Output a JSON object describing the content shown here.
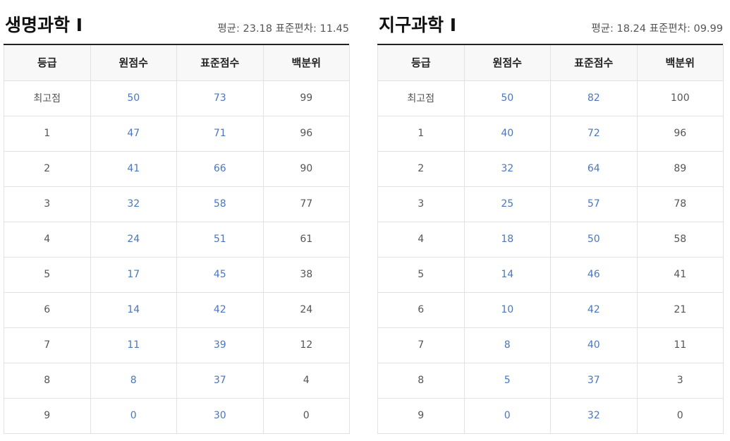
{
  "tables": [
    {
      "title": "생명과학 Ⅰ",
      "mean_label": "평균:",
      "mean_value": "23.18",
      "sd_label": "표준편차:",
      "sd_value": "11.45",
      "headers": [
        "등급",
        "원점수",
        "표준점수",
        "백분위"
      ],
      "rows": [
        [
          "최고점",
          "50",
          "73",
          "99"
        ],
        [
          "1",
          "47",
          "71",
          "96"
        ],
        [
          "2",
          "41",
          "66",
          "90"
        ],
        [
          "3",
          "32",
          "58",
          "77"
        ],
        [
          "4",
          "24",
          "51",
          "61"
        ],
        [
          "5",
          "17",
          "45",
          "38"
        ],
        [
          "6",
          "14",
          "42",
          "24"
        ],
        [
          "7",
          "11",
          "39",
          "12"
        ],
        [
          "8",
          "8",
          "37",
          "4"
        ],
        [
          "9",
          "0",
          "30",
          "0"
        ]
      ]
    },
    {
      "title": "지구과학 Ⅰ",
      "mean_label": "평균:",
      "mean_value": "18.24",
      "sd_label": "표준편차:",
      "sd_value": "09.99",
      "headers": [
        "등급",
        "원점수",
        "표준점수",
        "백분위"
      ],
      "rows": [
        [
          "최고점",
          "50",
          "82",
          "100"
        ],
        [
          "1",
          "40",
          "72",
          "96"
        ],
        [
          "2",
          "32",
          "64",
          "89"
        ],
        [
          "3",
          "25",
          "57",
          "78"
        ],
        [
          "4",
          "18",
          "50",
          "58"
        ],
        [
          "5",
          "14",
          "46",
          "41"
        ],
        [
          "6",
          "10",
          "42",
          "21"
        ],
        [
          "7",
          "8",
          "40",
          "11"
        ],
        [
          "8",
          "5",
          "37",
          "3"
        ],
        [
          "9",
          "0",
          "32",
          "0"
        ]
      ]
    }
  ],
  "colors": {
    "accent_blue": "#4a76c2",
    "header_bg": "#f8f8f8",
    "border": "#e2e2e2",
    "top_rule": "#222222"
  }
}
